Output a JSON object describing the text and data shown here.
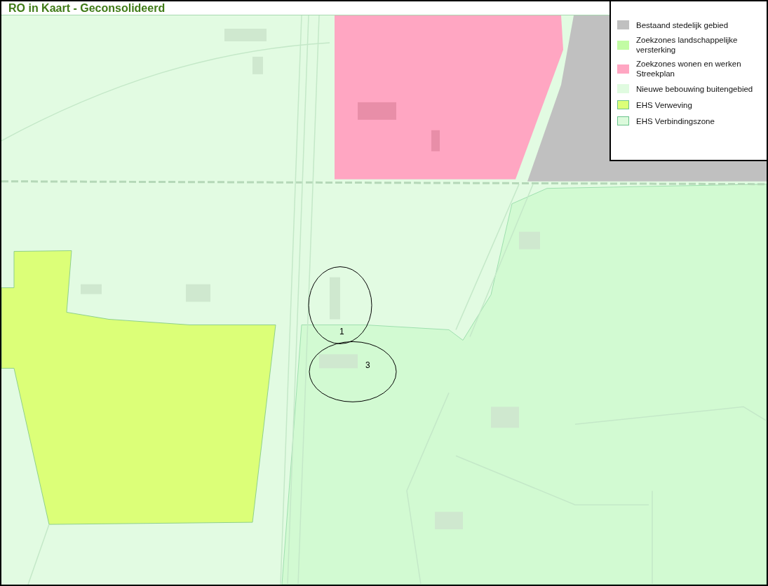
{
  "title": "RO in Kaart - Geconsolideerd",
  "legend": [
    {
      "label": "Bestaand stedelijk gebied",
      "color": "#c0c0c0",
      "kind": "filled"
    },
    {
      "label": "Zoekzones landschappelijke versterking",
      "color": "#c2fca4",
      "kind": "filled"
    },
    {
      "label": "Zoekzones wonen en werken Streekplan",
      "color": "#ffa6c2",
      "kind": "filled"
    },
    {
      "label": "Nieuwe bebouwing buitengebied",
      "color": "#e0fbe0",
      "kind": "filled"
    },
    {
      "label": "EHS Verweving",
      "color": "#dcff78",
      "kind": "outlined"
    },
    {
      "label": "EHS Verbindingszone",
      "color": "#dcfadc",
      "kind": "outlined"
    }
  ],
  "markers": [
    {
      "label": "1"
    },
    {
      "label": "3"
    }
  ]
}
